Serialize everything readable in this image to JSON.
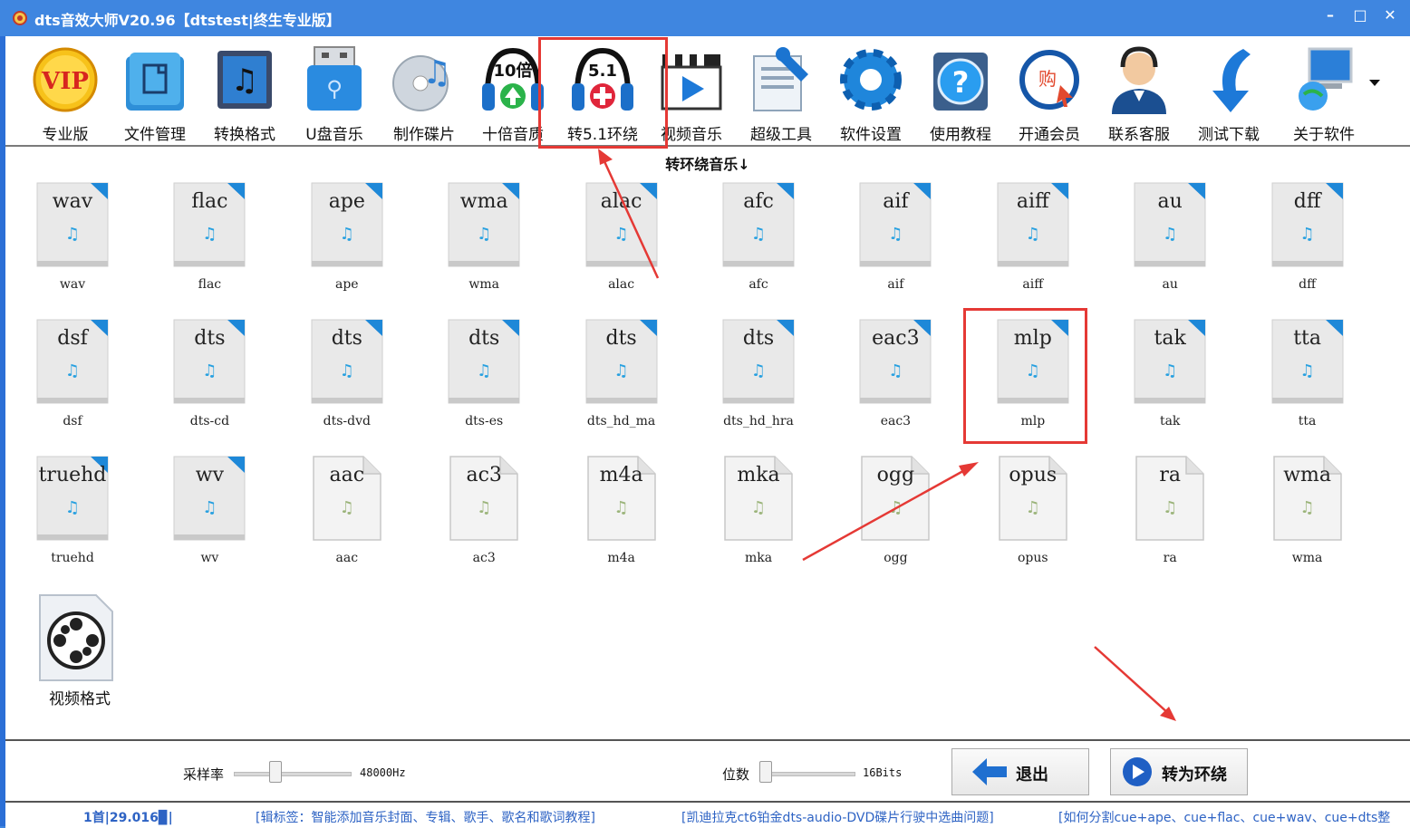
{
  "window": {
    "title": "dts音效大师V20.96【dtstest|终生专业版】",
    "buttons": {
      "minimize": "–",
      "maximize": "□",
      "close": "✕"
    }
  },
  "toolbar": {
    "items": [
      {
        "label": "专业版",
        "icon": "vip-icon",
        "badge": "VIP"
      },
      {
        "label": "文件管理",
        "icon": "file-manager-icon"
      },
      {
        "label": "转换格式",
        "icon": "convert-format-icon"
      },
      {
        "label": "U盘音乐",
        "icon": "usb-music-icon"
      },
      {
        "label": "制作碟片",
        "icon": "burn-disc-icon"
      },
      {
        "label": "十倍音质",
        "icon": "headphones-10x-icon",
        "badge": "10倍"
      },
      {
        "label": "转5.1环绕",
        "icon": "headphones-51-icon",
        "badge": "5.1"
      },
      {
        "label": "视频音乐",
        "icon": "video-clapper-icon"
      },
      {
        "label": "超级工具",
        "icon": "super-tools-icon"
      },
      {
        "label": "软件设置",
        "icon": "settings-gear-icon"
      },
      {
        "label": "使用教程",
        "icon": "help-icon"
      },
      {
        "label": "开通会员",
        "icon": "member-cart-icon",
        "badge": "购"
      },
      {
        "label": "联系客服",
        "icon": "customer-service-icon"
      },
      {
        "label": "测试下载",
        "icon": "download-arrow-icon"
      },
      {
        "label": "关于软件",
        "icon": "about-computer-icon"
      }
    ]
  },
  "section": {
    "title": "转环绕音乐↓"
  },
  "formats": [
    {
      "ext": "wav",
      "caption": "wav",
      "style": "blue"
    },
    {
      "ext": "flac",
      "caption": "flac",
      "style": "blue"
    },
    {
      "ext": "ape",
      "caption": "ape",
      "style": "blue"
    },
    {
      "ext": "wma",
      "caption": "wma",
      "style": "blue"
    },
    {
      "ext": "alac",
      "caption": "alac",
      "style": "blue"
    },
    {
      "ext": "afc",
      "caption": "afc",
      "style": "blue"
    },
    {
      "ext": "aif",
      "caption": "aif",
      "style": "blue"
    },
    {
      "ext": "aiff",
      "caption": "aiff",
      "style": "blue"
    },
    {
      "ext": "au",
      "caption": "au",
      "style": "blue"
    },
    {
      "ext": "dff",
      "caption": "dff",
      "style": "blue"
    },
    {
      "ext": "dsf",
      "caption": "dsf",
      "style": "blue"
    },
    {
      "ext": "dts",
      "caption": "dts-cd",
      "style": "blue"
    },
    {
      "ext": "dts",
      "caption": "dts-dvd",
      "style": "blue"
    },
    {
      "ext": "dts",
      "caption": "dts-es",
      "style": "blue"
    },
    {
      "ext": "dts",
      "caption": "dts_hd_ma",
      "style": "blue"
    },
    {
      "ext": "dts",
      "caption": "dts_hd_hra",
      "style": "blue"
    },
    {
      "ext": "eac3",
      "caption": "eac3",
      "style": "blue"
    },
    {
      "ext": "mlp",
      "caption": "mlp",
      "style": "blue"
    },
    {
      "ext": "tak",
      "caption": "tak",
      "style": "blue"
    },
    {
      "ext": "tta",
      "caption": "tta",
      "style": "blue"
    },
    {
      "ext": "truehd",
      "caption": "truehd",
      "style": "blue"
    },
    {
      "ext": "wv",
      "caption": "wv",
      "style": "blue"
    },
    {
      "ext": "aac",
      "caption": "aac",
      "style": "gray"
    },
    {
      "ext": "ac3",
      "caption": "ac3",
      "style": "gray"
    },
    {
      "ext": "m4a",
      "caption": "m4a",
      "style": "gray"
    },
    {
      "ext": "mka",
      "caption": "mka",
      "style": "gray"
    },
    {
      "ext": "ogg",
      "caption": "ogg",
      "style": "gray"
    },
    {
      "ext": "opus",
      "caption": "opus",
      "style": "gray"
    },
    {
      "ext": "ra",
      "caption": "ra",
      "style": "gray"
    },
    {
      "ext": "wma",
      "caption": "wma",
      "style": "gray"
    }
  ],
  "video_format": {
    "caption": "视频格式",
    "icon": "film-reel-icon"
  },
  "controls": {
    "sample_rate": {
      "label": "采样率",
      "value": "48000Hz"
    },
    "bit_depth": {
      "label": "位数",
      "value": "16Bits"
    },
    "exit_button": "退出",
    "convert_button": "转为环绕"
  },
  "status": {
    "count": "1首|29.016▉|",
    "link1": "[辑标签：智能添加音乐封面、专辑、歌手、歌名和歌词教程]",
    "link2": "[凯迪拉克ct6铂金dts-audio-DVD碟片行驶中选曲问题]",
    "link3": "[如何分割cue+ape、cue+flac、cue+wav、cue+dts整"
  },
  "colors": {
    "titlebar": "#3f86e0",
    "highlight": "#e53935",
    "link": "#2e63c4",
    "note_blue": "#27a0e0"
  }
}
